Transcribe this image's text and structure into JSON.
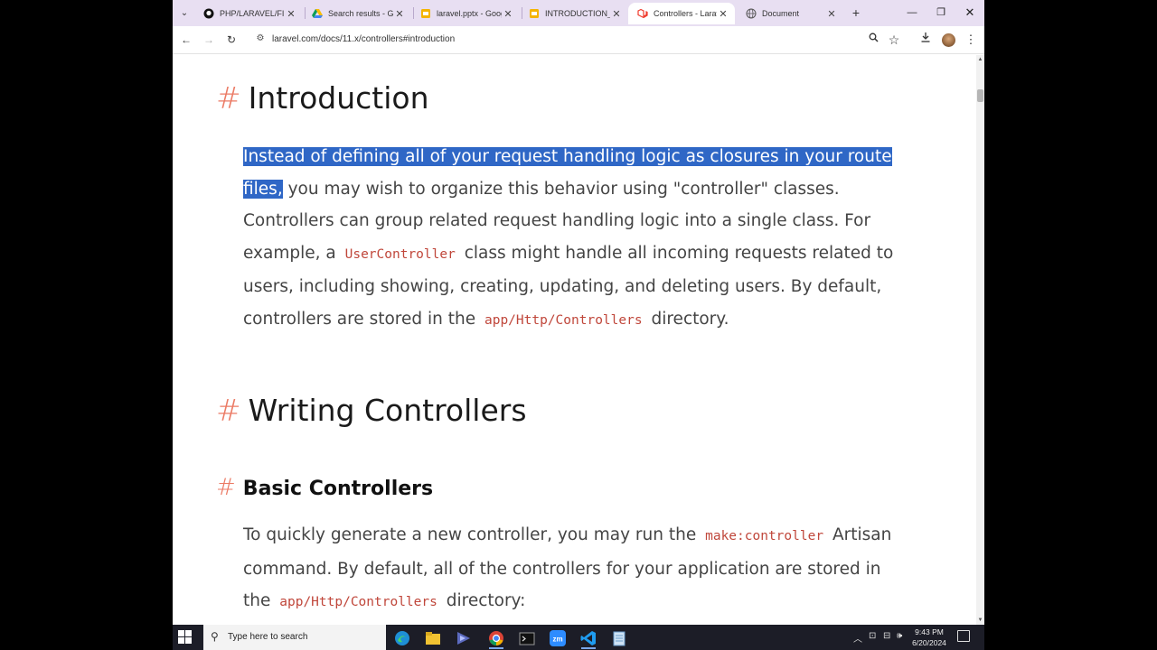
{
  "browser": {
    "tabs": [
      {
        "title": "PHP/LARAVEL/FIRST",
        "icon": "github-icon",
        "active": false
      },
      {
        "title": "Search results - Google Drive",
        "icon": "google-drive-icon",
        "active": false
      },
      {
        "title": "laravel.pptx - Google Slides",
        "icon": "google-slides-icon",
        "active": false
      },
      {
        "title": "INTRODUCTION_TO_LARAVEL",
        "icon": "google-slides-icon",
        "active": false
      },
      {
        "title": "Controllers - Laravel",
        "icon": "laravel-icon",
        "active": true
      },
      {
        "title": "Document",
        "icon": "globe-icon",
        "active": false
      }
    ],
    "url": "laravel.com/docs/11.x/controllers#introduction",
    "accent": "#e8dff2"
  },
  "page": {
    "hash": "#",
    "intro_heading": "Introduction",
    "intro_para": {
      "selected": "Instead of defining all of your request handling logic as closures in your route files,",
      "t1": " you may wish to organize this behavior using \"controller\" classes. Controllers can group related request handling logic into a single class. For example, a ",
      "code1": "UserController",
      "t2": " class might handle all incoming requests related to users, including showing, creating, updating, and deleting users. By default, controllers are stored in the ",
      "code2": "app/Http/Controllers",
      "t3": " directory."
    },
    "writing_heading": "Writing Controllers",
    "basic_heading": "Basic Controllers",
    "basic_para": {
      "t1": "To quickly generate a new controller, you may run the ",
      "code1": "make:controller",
      "t2": " Artisan command. By default, all of the controllers for your application are stored in the ",
      "code2": "app/Http/Controllers",
      "t3": " directory:"
    },
    "hash_color": "#eb7a64",
    "selection_color": "#2f67c6",
    "code_color": "#c0473b"
  },
  "taskbar": {
    "search_placeholder": "Type here to search",
    "time": "9:43 PM",
    "date": "6/20/2024",
    "apps": [
      "edge-icon",
      "file-explorer-icon",
      "media-player-icon",
      "chrome-icon",
      "terminal-icon",
      "zoom-icon",
      "vscode-icon",
      "notepad-icon"
    ]
  }
}
